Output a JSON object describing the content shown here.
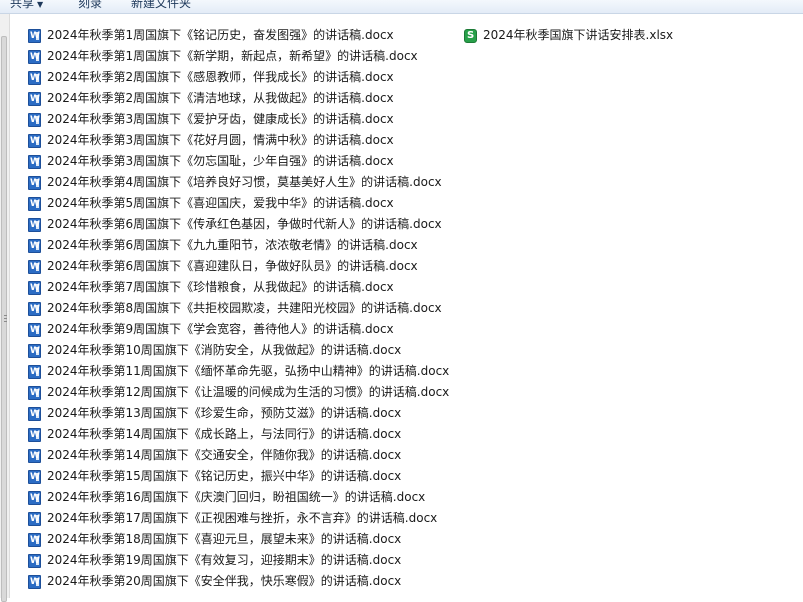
{
  "toolbar": {
    "share_label": "共享",
    "burn_label": "刻录",
    "new_folder_label": "新建文件夹"
  },
  "files_col1": [
    {
      "name": "2024年秋季第1周国旗下《铭记历史，奋发图强》的讲话稿.docx",
      "icon": "word-doc-icon"
    },
    {
      "name": "2024年秋季第1周国旗下《新学期，新起点，新希望》的讲话稿.docx",
      "icon": "word-doc-icon"
    },
    {
      "name": "2024年秋季第2周国旗下《感恩教师，伴我成长》的讲话稿.docx",
      "icon": "word-doc-icon"
    },
    {
      "name": "2024年秋季第2周国旗下《清洁地球，从我做起》的讲话稿.docx",
      "icon": "word-doc-icon"
    },
    {
      "name": "2024年秋季第3周国旗下《爱护牙齿，健康成长》的讲话稿.docx",
      "icon": "word-doc-icon"
    },
    {
      "name": "2024年秋季第3周国旗下《花好月圆，情满中秋》的讲话稿.docx",
      "icon": "word-doc-icon"
    },
    {
      "name": "2024年秋季第3周国旗下《勿忘国耻，少年自强》的讲话稿.docx",
      "icon": "word-doc-icon"
    },
    {
      "name": "2024年秋季第4周国旗下《培养良好习惯，莫基美好人生》的讲话稿.docx",
      "icon": "word-doc-icon"
    },
    {
      "name": "2024年秋季第5周国旗下《喜迎国庆，爱我中华》的讲话稿.docx",
      "icon": "word-doc-icon"
    },
    {
      "name": "2024年秋季第6周国旗下《传承红色基因，争做时代新人》的讲话稿.docx",
      "icon": "word-doc-icon"
    },
    {
      "name": "2024年秋季第6周国旗下《九九重阳节，浓浓敬老情》的讲话稿.docx",
      "icon": "word-doc-icon"
    },
    {
      "name": "2024年秋季第6周国旗下《喜迎建队日，争做好队员》的讲话稿.docx",
      "icon": "word-doc-icon"
    },
    {
      "name": "2024年秋季第7周国旗下《珍惜粮食，从我做起》的讲话稿.docx",
      "icon": "word-doc-icon"
    },
    {
      "name": "2024年秋季第8周国旗下《共拒校园欺凌，共建阳光校园》的讲话稿.docx",
      "icon": "word-doc-icon"
    },
    {
      "name": "2024年秋季第9周国旗下《学会宽容，善待他人》的讲话稿.docx",
      "icon": "word-doc-icon"
    },
    {
      "name": "2024年秋季第10周国旗下《消防安全，从我做起》的讲话稿.docx",
      "icon": "word-doc-icon"
    },
    {
      "name": "2024年秋季第11周国旗下《缅怀革命先驱，弘扬中山精神》的讲话稿.docx",
      "icon": "word-doc-icon"
    },
    {
      "name": "2024年秋季第12周国旗下《让温暖的问候成为生活的习惯》的讲话稿.docx",
      "icon": "word-doc-icon"
    },
    {
      "name": "2024年秋季第13周国旗下《珍爱生命，预防艾滋》的讲话稿.docx",
      "icon": "word-doc-icon"
    },
    {
      "name": "2024年秋季第14周国旗下《成长路上，与法同行》的讲话稿.docx",
      "icon": "word-doc-icon"
    },
    {
      "name": "2024年秋季第14周国旗下《交通安全，伴随你我》的讲话稿.docx",
      "icon": "word-doc-icon"
    },
    {
      "name": "2024年秋季第15周国旗下《铭记历史，振兴中华》的讲话稿.docx",
      "icon": "word-doc-icon"
    },
    {
      "name": "2024年秋季第16周国旗下《庆澳门回归，盼祖国统一》的讲话稿.docx",
      "icon": "word-doc-icon"
    },
    {
      "name": "2024年秋季第17周国旗下《正视困难与挫折，永不言弃》的讲话稿.docx",
      "icon": "word-doc-icon"
    },
    {
      "name": "2024年秋季第18周国旗下《喜迎元旦，展望未来》的讲话稿.docx",
      "icon": "word-doc-icon"
    },
    {
      "name": "2024年秋季第19周国旗下《有效复习，迎接期末》的讲话稿.docx",
      "icon": "word-doc-icon"
    },
    {
      "name": "2024年秋季第20周国旗下《安全伴我，快乐寒假》的讲话稿.docx",
      "icon": "word-doc-icon"
    }
  ],
  "files_col2": [
    {
      "name": "2024年秋季国旗下讲话安排表.xlsx",
      "icon": "excel-sheet-icon"
    }
  ],
  "colors": {
    "word_icon": "#2b6cc4",
    "excel_icon": "#27a049",
    "toolbar_text": "#1e395b"
  }
}
